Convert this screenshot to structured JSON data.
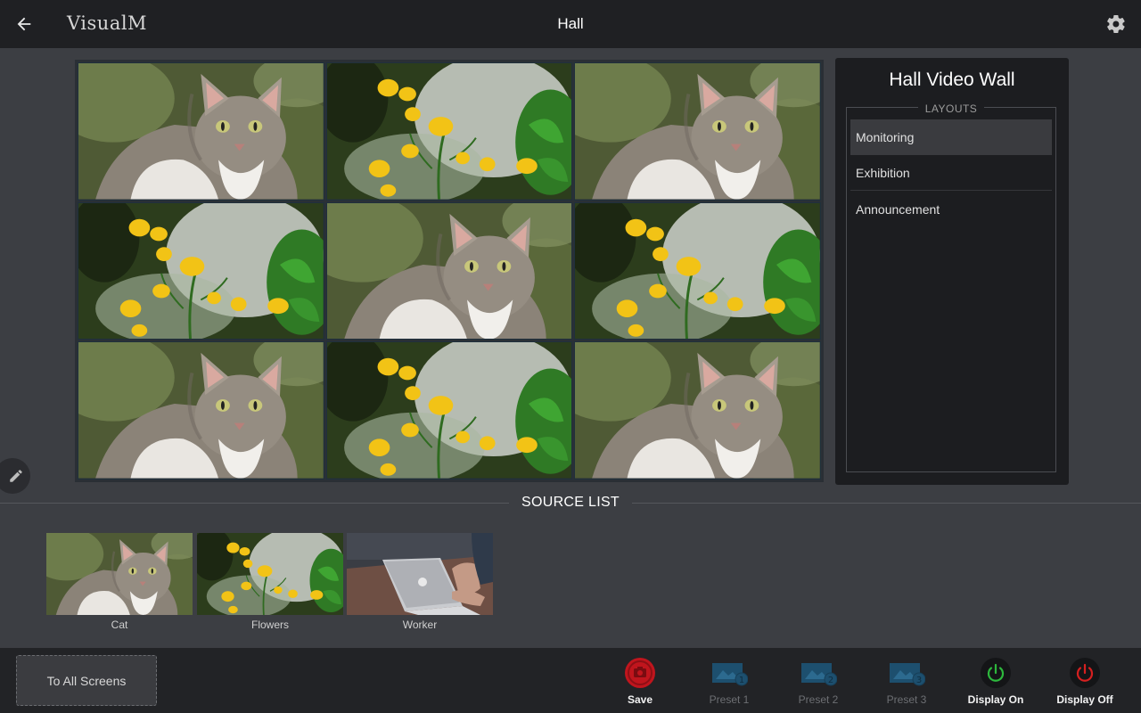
{
  "header": {
    "app_title": "VisualM",
    "page_title": "Hall"
  },
  "wall": {
    "tiles": [
      "cat",
      "flowers",
      "cat",
      "flowers",
      "cat",
      "flowers",
      "cat",
      "flowers",
      "cat"
    ]
  },
  "layout_panel": {
    "title": "Hall Video Wall",
    "legend": "LAYOUTS",
    "items": [
      {
        "label": "Monitoring",
        "active": true
      },
      {
        "label": "Exhibition",
        "active": false
      },
      {
        "label": "Announcement",
        "active": false
      }
    ]
  },
  "source_list": {
    "title": "SOURCE LIST",
    "sources": [
      {
        "label": "Cat",
        "icon": "cat-image"
      },
      {
        "label": "Flowers",
        "icon": "flowers-image"
      },
      {
        "label": "Worker",
        "icon": "laptop-image"
      }
    ]
  },
  "bottom_bar": {
    "to_all": "To All Screens",
    "save": "Save",
    "preset1": "Preset 1",
    "preset2": "Preset 2",
    "preset3": "Preset 3",
    "display_on": "Display On",
    "display_off": "Display Off"
  },
  "colors": {
    "save_red": "#c0151d",
    "power_on_green": "#2db83d",
    "power_off_red": "#d62020",
    "preset_blue": "#1d4f6e"
  }
}
